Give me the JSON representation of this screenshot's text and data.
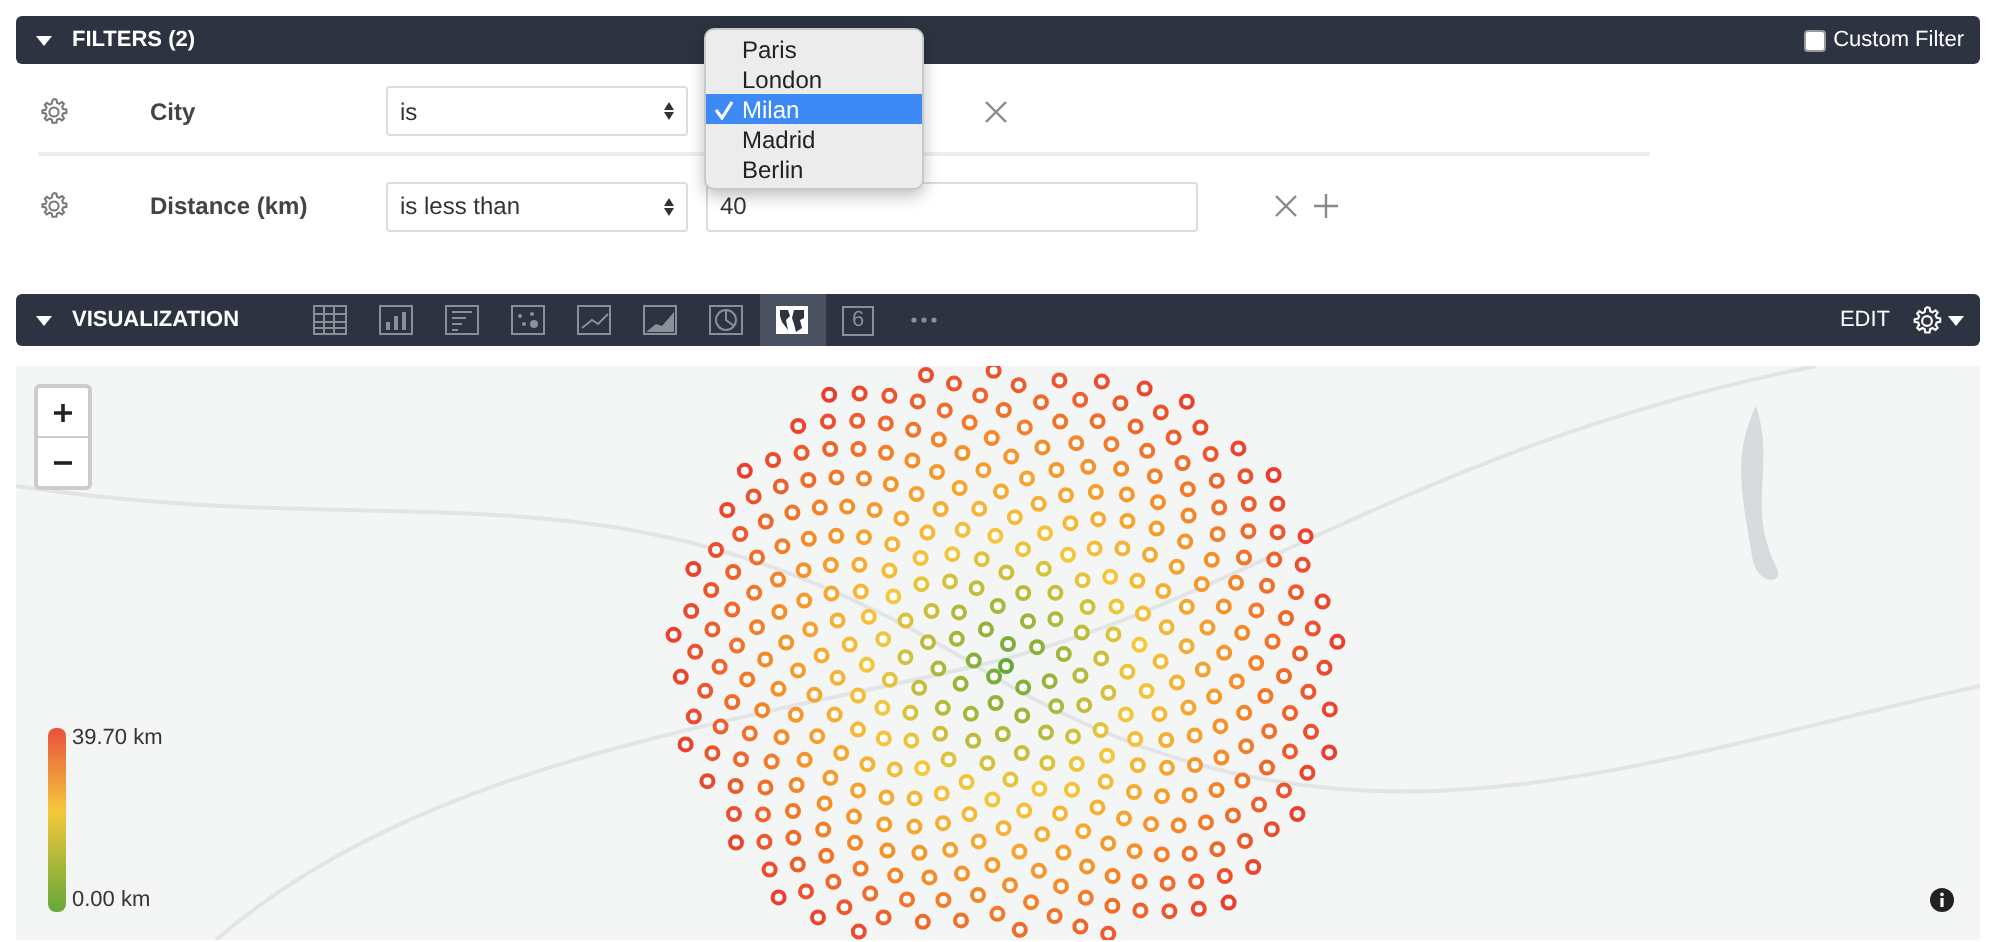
{
  "filters": {
    "title": "FILTERS (2)",
    "expanded": true,
    "custom_filter": {
      "label": "Custom Filter",
      "checked": false
    },
    "rows": [
      {
        "field": "City",
        "operator": "is",
        "value": ""
      },
      {
        "field": "Distance (km)",
        "operator": "is less than",
        "value": "40"
      }
    ],
    "dropdown": {
      "options": [
        {
          "label": "Paris",
          "selected": false
        },
        {
          "label": "London",
          "selected": false
        },
        {
          "label": "Milan",
          "selected": true
        },
        {
          "label": "Madrid",
          "selected": false
        },
        {
          "label": "Berlin",
          "selected": false
        }
      ]
    }
  },
  "visualization": {
    "title": "VISUALIZATION",
    "expanded": true,
    "chart_types": [
      {
        "kind": "table",
        "selected": false
      },
      {
        "kind": "bar",
        "selected": false
      },
      {
        "kind": "hbar",
        "selected": false
      },
      {
        "kind": "scatter",
        "selected": false
      },
      {
        "kind": "line",
        "selected": false
      },
      {
        "kind": "area",
        "selected": false
      },
      {
        "kind": "pie",
        "selected": false
      },
      {
        "kind": "map",
        "selected": true
      },
      {
        "kind": "number",
        "label": "6",
        "selected": false
      },
      {
        "kind": "more",
        "selected": false
      }
    ],
    "edit": "EDIT",
    "legend": {
      "max": "39.70 km",
      "min": "0.00 km"
    }
  }
}
